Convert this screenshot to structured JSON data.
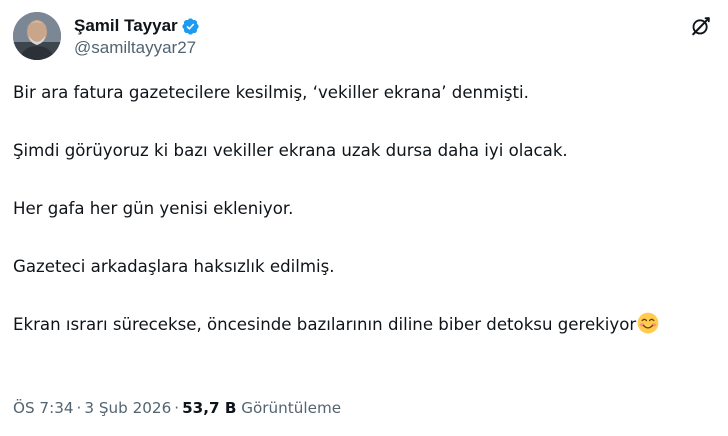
{
  "author": {
    "display_name": "Şamil Tayyar",
    "handle": "@samiltayyar27",
    "verified": true
  },
  "icons": {
    "verified": "verified-badge-icon",
    "grok": "grok-icon",
    "emoji": "smiling-face-emoji"
  },
  "colors": {
    "verified": "#1d9bf0",
    "text": "#0f1419",
    "secondary": "#536471"
  },
  "tweet": {
    "paragraphs": [
      "Bir ara fatura gazetecilere kesilmiş, ‘vekiller ekrana’ denmişti.",
      "Şimdi görüyoruz ki bazı vekiller ekrana uzak dursa daha iyi olacak.",
      "Her gafa her gün yenisi ekleniyor.",
      "Gazeteci arkadaşlara haksızlık edilmiş.",
      "Ekran ısrarı sürecekse, öncesinde bazılarının diline biber detoksu gerekiyor"
    ]
  },
  "meta": {
    "time": "ÖS 7:34",
    "separator": "·",
    "date": "3 Şub 2026",
    "views_count": "53,7 B",
    "views_label": "Görüntüleme"
  }
}
